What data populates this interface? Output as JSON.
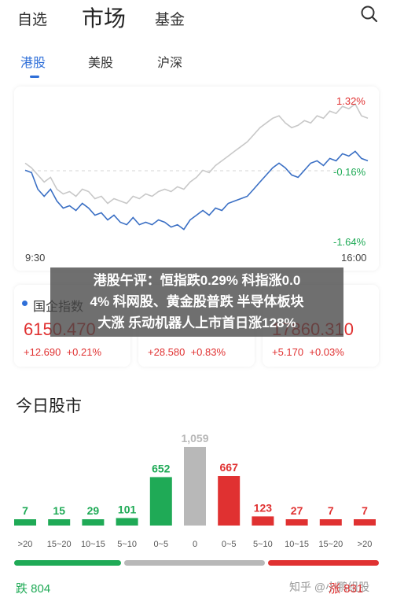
{
  "topnav": {
    "tabs": [
      "自选",
      "市场",
      "基金"
    ],
    "active": 1
  },
  "market_tabs": {
    "tabs": [
      "港股",
      "美股",
      "沪深"
    ],
    "active": 0
  },
  "colors": {
    "accent": "#2f6fd8",
    "up": "#e03131",
    "down": "#1faa56",
    "neutral": "#b8b8b8"
  },
  "chart_data": [
    {
      "type": "line",
      "x": [
        "9:30",
        "16:00"
      ],
      "ylabels": [
        "1.32%",
        "-0.16%",
        "-1.64%"
      ],
      "ylim": [
        -1.64,
        1.32
      ],
      "series": [
        {
          "color": "#3a6fc4",
          "values": [
            -0.15,
            -0.2,
            -0.55,
            -0.7,
            -0.55,
            -0.8,
            -0.95,
            -0.9,
            -1.0,
            -0.85,
            -0.95,
            -1.1,
            -1.05,
            -1.2,
            -1.1,
            -1.25,
            -1.3,
            -1.15,
            -1.3,
            -1.25,
            -1.3,
            -1.2,
            -1.25,
            -1.35,
            -1.3,
            -1.4,
            -1.2,
            -1.1,
            -1.0,
            -1.1,
            -0.95,
            -1.0,
            -0.85,
            -0.8,
            -0.75,
            -0.7,
            -0.55,
            -0.4,
            -0.25,
            -0.1,
            0.0,
            -0.1,
            -0.25,
            -0.3,
            -0.15,
            0.0,
            0.05,
            -0.05,
            0.1,
            0.05,
            0.2,
            0.15,
            0.25,
            0.1,
            0.05
          ]
        },
        {
          "color": "#c8c8c8",
          "values": [
            0.0,
            -0.1,
            -0.25,
            -0.4,
            -0.3,
            -0.55,
            -0.65,
            -0.6,
            -0.7,
            -0.55,
            -0.6,
            -0.75,
            -0.7,
            -0.85,
            -0.75,
            -0.8,
            -0.85,
            -0.7,
            -0.75,
            -0.65,
            -0.7,
            -0.6,
            -0.55,
            -0.6,
            -0.5,
            -0.55,
            -0.4,
            -0.3,
            -0.15,
            -0.2,
            -0.05,
            0.05,
            0.15,
            0.25,
            0.35,
            0.45,
            0.6,
            0.75,
            0.85,
            0.95,
            1.0,
            0.85,
            0.75,
            0.8,
            0.9,
            0.85,
            1.0,
            0.95,
            1.1,
            1.05,
            1.2,
            1.15,
            1.25,
            1.0,
            0.95
          ]
        }
      ]
    },
    {
      "type": "bar",
      "categories": [
        ">20",
        "15~20",
        "10~15",
        "5~10",
        "0~5",
        "0",
        "0~5",
        "5~10",
        "10~15",
        "15~20",
        ">20"
      ],
      "values": [
        7,
        15,
        29,
        101,
        652,
        1059,
        667,
        123,
        27,
        7,
        7
      ],
      "value_labels": [
        "7",
        "15",
        "29",
        "101",
        "652",
        "1,059",
        "667",
        "123",
        "27",
        "7",
        "7"
      ],
      "colors": [
        "#1faa56",
        "#1faa56",
        "#1faa56",
        "#1faa56",
        "#1faa56",
        "#b8b8b8",
        "#e03131",
        "#e03131",
        "#e03131",
        "#e03131",
        "#e03131"
      ]
    }
  ],
  "indices": [
    {
      "name": "国企指数",
      "price": "6150.470",
      "change": "+12.690",
      "pct": "+0.21%"
    },
    {
      "name": "",
      "price": "",
      "change": "+28.580",
      "pct": "+0.83%"
    },
    {
      "name": "",
      "price": "17860.310",
      "change": "+5.170",
      "pct": "+0.03%"
    }
  ],
  "headline": {
    "line1": "港股午评：恒指跌0.29% 科指涨0.0",
    "line2": "4% 科网股、黄金股普跌 半导体板块",
    "line3": "大涨 乐动机器人上市首日涨128%"
  },
  "today": {
    "title": "今日股市",
    "fall_label": "跌 804",
    "rise_label": "涨 831"
  },
  "breadth": {
    "fall": 804,
    "flat": 1059,
    "rise": 831
  },
  "watermark": "知乎 @小鹏组股"
}
